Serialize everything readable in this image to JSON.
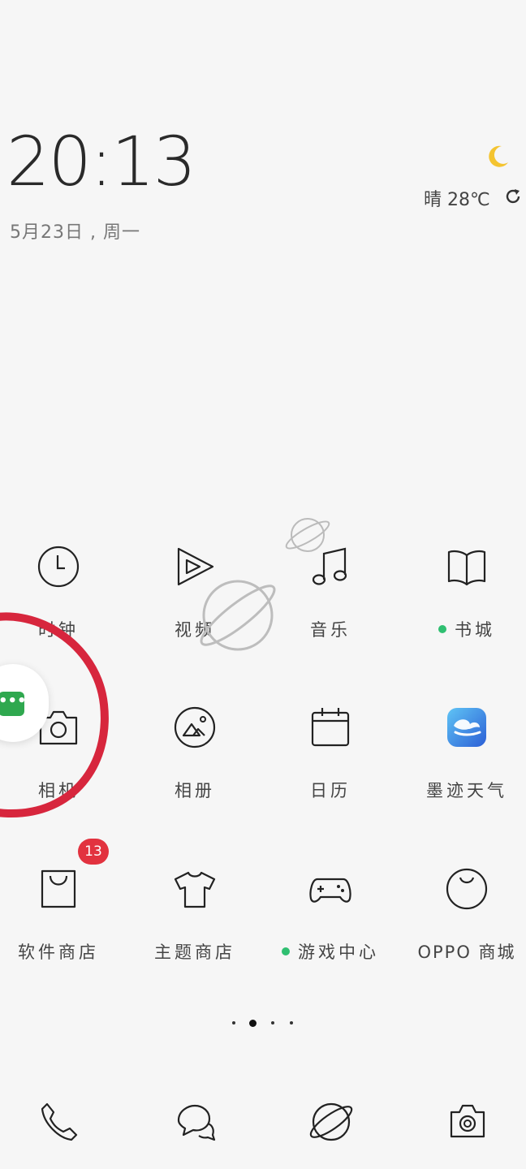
{
  "lockscreen": {
    "time": "20:13",
    "date": "5月23日 , 周一"
  },
  "weather": {
    "condition_icon": "moon-icon",
    "text": "晴 28℃",
    "refresh_icon": "refresh-icon",
    "moon_color": "#f4c430"
  },
  "apps": [
    {
      "label": "时钟",
      "icon": "clock-icon"
    },
    {
      "label": "视频",
      "icon": "play-icon"
    },
    {
      "label": "音乐",
      "icon": "music-note-icon"
    },
    {
      "label": "书城",
      "icon": "book-icon",
      "dot": true
    },
    {
      "label": "相机",
      "icon": "camera-icon"
    },
    {
      "label": "相册",
      "icon": "gallery-icon"
    },
    {
      "label": "日历",
      "icon": "calendar-icon"
    },
    {
      "label": "墨迹天气",
      "icon": "moji-weather-icon"
    },
    {
      "label": "软件商店",
      "icon": "shopping-bag-icon",
      "badge": "13"
    },
    {
      "label": "主题商店",
      "icon": "tshirt-icon"
    },
    {
      "label": "游戏中心",
      "icon": "gamepad-icon",
      "dot": true
    },
    {
      "label": "OPPO 商城",
      "icon": "oppo-store-icon"
    }
  ],
  "badge_color": "#e2323f",
  "dot_color": "#2fbf71",
  "pager": {
    "pages": 4,
    "current": 2
  },
  "dock": [
    {
      "icon": "phone-icon"
    },
    {
      "icon": "messages-icon"
    },
    {
      "icon": "browser-planet-icon"
    },
    {
      "icon": "camera-settings-icon"
    }
  ],
  "floating_assistant": {
    "icon": "chat-more-icon",
    "label": "•••",
    "color": "#2fa84f"
  },
  "annotation": {
    "color": "#d7263d",
    "shape": "red-circle-annotation"
  }
}
